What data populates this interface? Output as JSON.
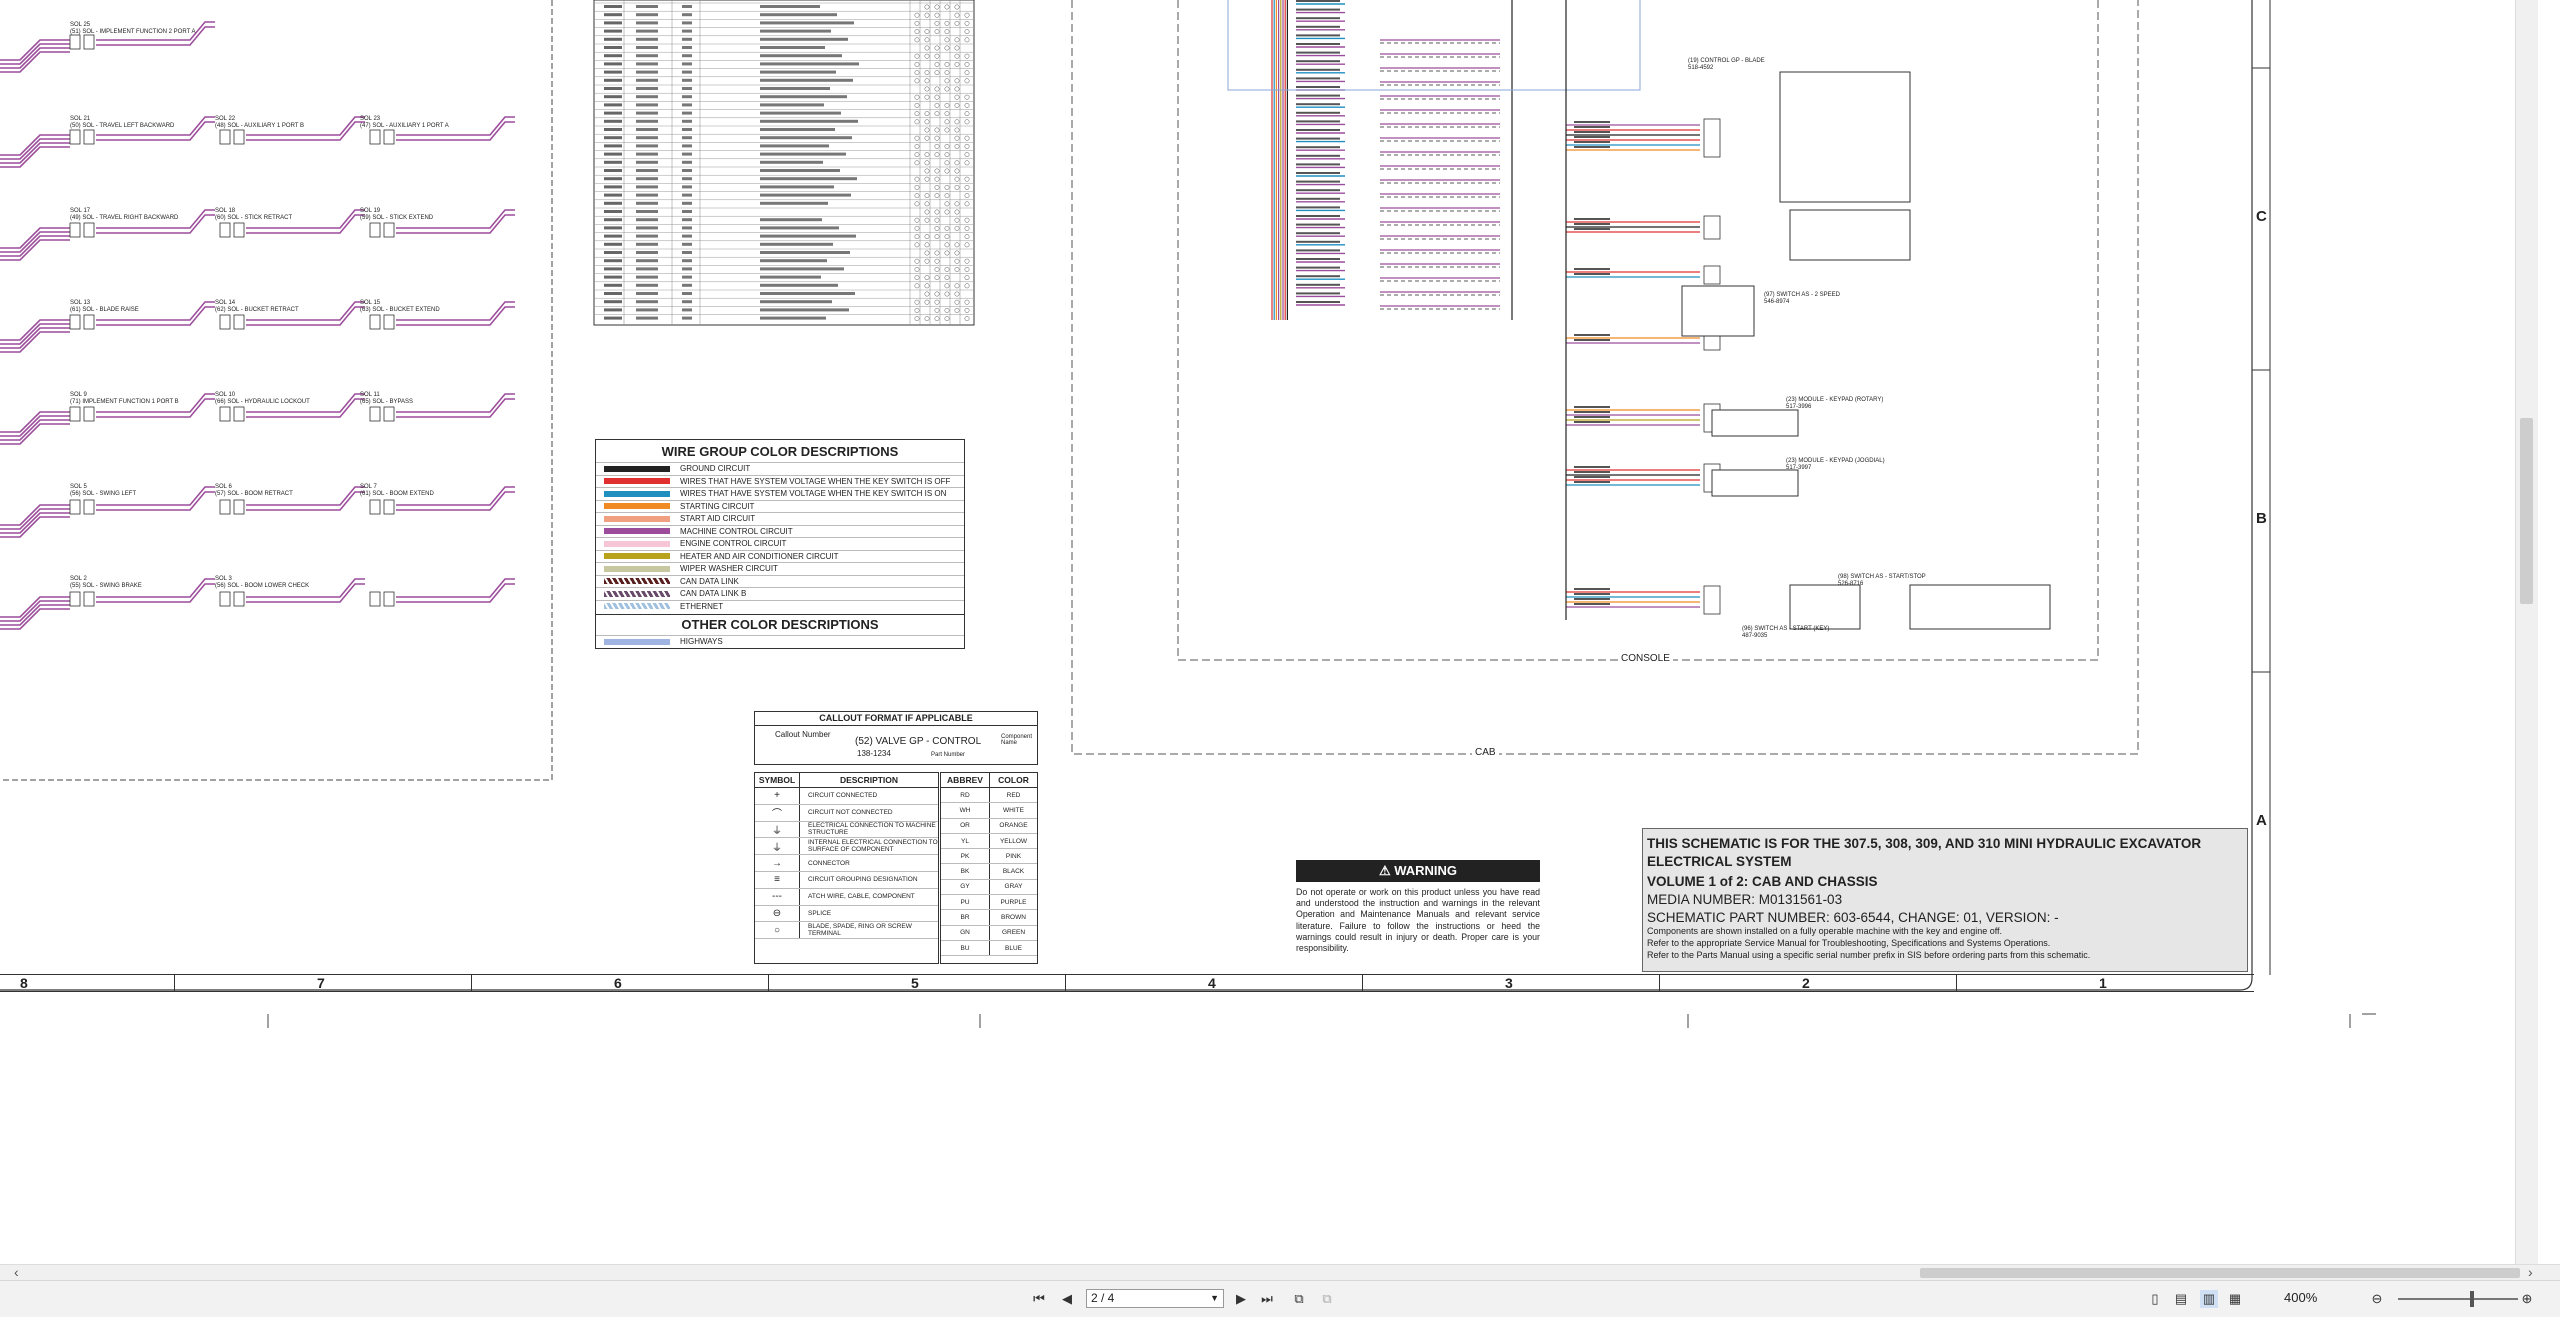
{
  "wire_legend": {
    "title": "WIRE GROUP COLOR DESCRIPTIONS",
    "items": [
      {
        "label": "GROUND CIRCUIT",
        "color": "#222222"
      },
      {
        "label": "WIRES THAT HAVE SYSTEM VOLTAGE WHEN THE KEY SWITCH IS OFF",
        "color": "#e03030"
      },
      {
        "label": "WIRES THAT HAVE SYSTEM VOLTAGE WHEN THE KEY SWITCH IS ON",
        "color": "#1f8fbf"
      },
      {
        "label": "STARTING CIRCUIT",
        "color": "#f08a24"
      },
      {
        "label": "START AID CIRCUIT",
        "color": "#f0a080"
      },
      {
        "label": "MACHINE CONTROL CIRCUIT",
        "color": "#9b4d9b"
      },
      {
        "label": "ENGINE CONTROL CIRCUIT",
        "color": "#f7c6d6"
      },
      {
        "label": "HEATER AND AIR CONDITIONER CIRCUIT",
        "color": "#b9a21c"
      },
      {
        "label": "WIPER WASHER CIRCUIT",
        "color": "#c8c8a0"
      },
      {
        "label": "CAN DATA LINK",
        "color": "#5a2020"
      },
      {
        "label": "CAN DATA LINK B",
        "color": "#6a4a6a"
      },
      {
        "label": "ETHERNET",
        "color": "#a0c0e0"
      }
    ],
    "other_title": "OTHER COLOR DESCRIPTIONS",
    "other_items": [
      {
        "label": "HIGHWAYS",
        "color": "#9fb4e0"
      }
    ]
  },
  "callout": {
    "title": "CALLOUT FORMAT IF APPLICABLE",
    "callout_number": "Callout Number",
    "example": "(52) VALVE GP - CONTROL",
    "part": "138-1234",
    "component_name": "Component Name",
    "part_number": "Part Number"
  },
  "symbols": {
    "headers": {
      "symbol": "SYMBOL",
      "description": "DESCRIPTION"
    },
    "rows": [
      {
        "sym": "+",
        "desc": "CIRCUIT CONNECTED"
      },
      {
        "sym": "⌒",
        "desc": "CIRCUIT NOT CONNECTED"
      },
      {
        "sym": "⏚",
        "desc": "ELECTRICAL CONNECTION TO MACHINE STRUCTURE"
      },
      {
        "sym": "⏚",
        "desc": "INTERNAL ELECTRICAL CONNECTION TO SURFACE OF COMPONENT"
      },
      {
        "sym": "→",
        "desc": "CONNECTOR"
      },
      {
        "sym": "≡",
        "desc": "CIRCUIT GROUPING DESIGNATION"
      },
      {
        "sym": "---",
        "desc": "ATCH WIRE, CABLE, COMPONENT"
      },
      {
        "sym": "⊖",
        "desc": "SPLICE"
      },
      {
        "sym": "○",
        "desc": "BLADE, SPADE, RING OR SCREW TERMINAL"
      }
    ]
  },
  "abbreviations": {
    "headers": {
      "abbrev": "ABBREV",
      "color": "COLOR"
    },
    "rows": [
      {
        "ab": "RD",
        "col": "RED"
      },
      {
        "ab": "WH",
        "col": "WHITE"
      },
      {
        "ab": "OR",
        "col": "ORANGE"
      },
      {
        "ab": "YL",
        "col": "YELLOW"
      },
      {
        "ab": "PK",
        "col": "PINK"
      },
      {
        "ab": "BK",
        "col": "BLACK"
      },
      {
        "ab": "GY",
        "col": "GRAY"
      },
      {
        "ab": "PU",
        "col": "PURPLE"
      },
      {
        "ab": "BR",
        "col": "BROWN"
      },
      {
        "ab": "GN",
        "col": "GREEN"
      },
      {
        "ab": "BU",
        "col": "BLUE"
      }
    ]
  },
  "warning": {
    "title": "WARNING",
    "text": "Do not operate or work on this product unless you have read and understood the instruction and warnings in the relevant Operation and Maintenance Manuals and relevant service literature. Failure to follow the instructions or heed the warnings could result in injury or death. Proper care is your responsibility."
  },
  "title_block": {
    "line1": "THIS SCHEMATIC IS FOR THE 307.5, 308, 309, AND 310 MINI HYDRAULIC EXCAVATOR",
    "line2": "ELECTRICAL SYSTEM",
    "volume": "VOLUME 1 of 2: CAB AND CHASSIS",
    "media": "MEDIA NUMBER: M0131561-03",
    "part": "SCHEMATIC PART NUMBER: 603-6544, CHANGE: 01, VERSION: -",
    "note1": "Components are shown installed on a fully operable machine with the key and engine off.",
    "note2": "Refer to the appropriate Service Manual for Troubleshooting, Specifications and Systems Operations.",
    "note3": "Refer to the Parts Manual using a specific serial number prefix in SIS before ordering parts from this schematic."
  },
  "zones": [
    "8",
    "7",
    "6",
    "5",
    "4",
    "3",
    "2",
    "1"
  ],
  "row_zones": [
    "C",
    "B",
    "A"
  ],
  "area_labels": {
    "console": "CONSOLE",
    "cab": "CAB"
  },
  "solenoids": [
    {
      "title": "SOL 25",
      "name": "(51) SOL - IMPLEMENT FUNCTION 2 PORT A"
    },
    {
      "title": "SOL 21",
      "name": "(50) SOL - TRAVEL LEFT BACKWARD"
    },
    {
      "title": "SOL 22",
      "name": "(48) SOL - AUXILIARY 1 PORT B"
    },
    {
      "title": "SOL 23",
      "name": "(47) SOL - AUXILIARY 1 PORT A"
    },
    {
      "title": "SOL 17",
      "name": "(49) SOL - TRAVEL RIGHT BACKWARD"
    },
    {
      "title": "SOL 18",
      "name": "(60) SOL - STICK RETRACT"
    },
    {
      "title": "SOL 19",
      "name": "(59) SOL - STICK EXTEND"
    },
    {
      "title": "SOL 13",
      "name": "(61) SOL - BLADE RAISE"
    },
    {
      "title": "SOL 14",
      "name": "(62) SOL - BUCKET RETRACT"
    },
    {
      "title": "SOL 15",
      "name": "(63) SOL - BUCKET EXTEND"
    },
    {
      "title": "SOL 9",
      "name": "(71) IMPLEMENT FUNCTION 1 PORT B"
    },
    {
      "title": "SOL 10",
      "name": "(66) SOL - HYDRAULIC LOCKOUT"
    },
    {
      "title": "SOL 11",
      "name": "(65) SOL - BYPASS"
    },
    {
      "title": "SOL 5",
      "name": "(56) SOL - SWING LEFT"
    },
    {
      "title": "SOL 6",
      "name": "(57) SOL - BOOM RETRACT"
    },
    {
      "title": "SOL 7",
      "name": "(61) SOL - BOOM EXTEND"
    },
    {
      "title": "SOL 2",
      "name": "(55) SOL - SWING BRAKE"
    },
    {
      "title": "SOL 3",
      "name": "(56) SOL - BOOM LOWER CHECK"
    }
  ],
  "components": [
    {
      "name": "(19) CONTROL GP - BLADE",
      "part": "518-4592"
    },
    {
      "name": "(97) SWITCH AS - 2 SPEED",
      "part": "546-8974"
    },
    {
      "name": "(23) MODULE - KEYPAD (ROTARY)",
      "part": "517-3996"
    },
    {
      "name": "(23) MODULE - KEYPAD (JOGDIAL)",
      "part": "517-3997"
    },
    {
      "name": "(98) SWITCH AS - START/STOP",
      "part": "526-8716"
    },
    {
      "name": "(96) SWITCH AS - START (KEY)",
      "part": "487-9035"
    }
  ],
  "viewer": {
    "page": "2 / 4",
    "zoom": "400%"
  }
}
